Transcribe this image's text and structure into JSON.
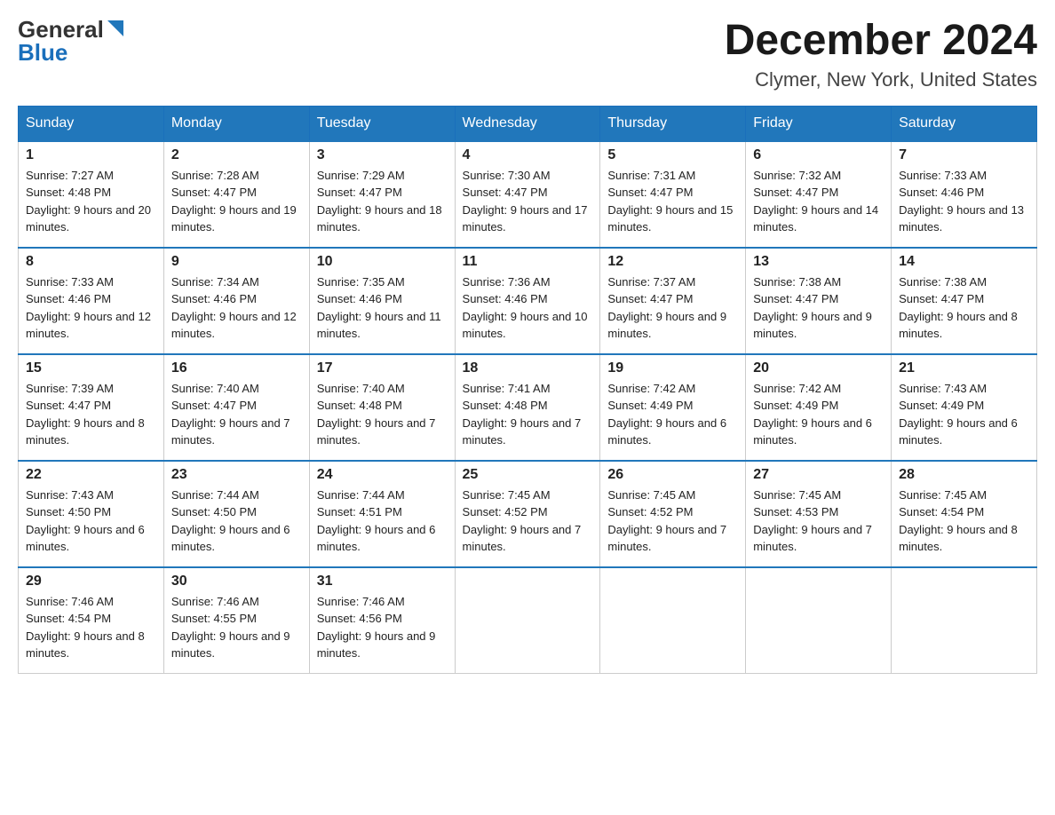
{
  "header": {
    "logo_general": "General",
    "logo_blue": "Blue",
    "month_title": "December 2024",
    "location": "Clymer, New York, United States"
  },
  "days_of_week": [
    "Sunday",
    "Monday",
    "Tuesday",
    "Wednesday",
    "Thursday",
    "Friday",
    "Saturday"
  ],
  "weeks": [
    [
      {
        "day": "1",
        "sunrise": "7:27 AM",
        "sunset": "4:48 PM",
        "daylight": "9 hours and 20 minutes."
      },
      {
        "day": "2",
        "sunrise": "7:28 AM",
        "sunset": "4:47 PM",
        "daylight": "9 hours and 19 minutes."
      },
      {
        "day": "3",
        "sunrise": "7:29 AM",
        "sunset": "4:47 PM",
        "daylight": "9 hours and 18 minutes."
      },
      {
        "day": "4",
        "sunrise": "7:30 AM",
        "sunset": "4:47 PM",
        "daylight": "9 hours and 17 minutes."
      },
      {
        "day": "5",
        "sunrise": "7:31 AM",
        "sunset": "4:47 PM",
        "daylight": "9 hours and 15 minutes."
      },
      {
        "day": "6",
        "sunrise": "7:32 AM",
        "sunset": "4:47 PM",
        "daylight": "9 hours and 14 minutes."
      },
      {
        "day": "7",
        "sunrise": "7:33 AM",
        "sunset": "4:46 PM",
        "daylight": "9 hours and 13 minutes."
      }
    ],
    [
      {
        "day": "8",
        "sunrise": "7:33 AM",
        "sunset": "4:46 PM",
        "daylight": "9 hours and 12 minutes."
      },
      {
        "day": "9",
        "sunrise": "7:34 AM",
        "sunset": "4:46 PM",
        "daylight": "9 hours and 12 minutes."
      },
      {
        "day": "10",
        "sunrise": "7:35 AM",
        "sunset": "4:46 PM",
        "daylight": "9 hours and 11 minutes."
      },
      {
        "day": "11",
        "sunrise": "7:36 AM",
        "sunset": "4:46 PM",
        "daylight": "9 hours and 10 minutes."
      },
      {
        "day": "12",
        "sunrise": "7:37 AM",
        "sunset": "4:47 PM",
        "daylight": "9 hours and 9 minutes."
      },
      {
        "day": "13",
        "sunrise": "7:38 AM",
        "sunset": "4:47 PM",
        "daylight": "9 hours and 9 minutes."
      },
      {
        "day": "14",
        "sunrise": "7:38 AM",
        "sunset": "4:47 PM",
        "daylight": "9 hours and 8 minutes."
      }
    ],
    [
      {
        "day": "15",
        "sunrise": "7:39 AM",
        "sunset": "4:47 PM",
        "daylight": "9 hours and 8 minutes."
      },
      {
        "day": "16",
        "sunrise": "7:40 AM",
        "sunset": "4:47 PM",
        "daylight": "9 hours and 7 minutes."
      },
      {
        "day": "17",
        "sunrise": "7:40 AM",
        "sunset": "4:48 PM",
        "daylight": "9 hours and 7 minutes."
      },
      {
        "day": "18",
        "sunrise": "7:41 AM",
        "sunset": "4:48 PM",
        "daylight": "9 hours and 7 minutes."
      },
      {
        "day": "19",
        "sunrise": "7:42 AM",
        "sunset": "4:49 PM",
        "daylight": "9 hours and 6 minutes."
      },
      {
        "day": "20",
        "sunrise": "7:42 AM",
        "sunset": "4:49 PM",
        "daylight": "9 hours and 6 minutes."
      },
      {
        "day": "21",
        "sunrise": "7:43 AM",
        "sunset": "4:49 PM",
        "daylight": "9 hours and 6 minutes."
      }
    ],
    [
      {
        "day": "22",
        "sunrise": "7:43 AM",
        "sunset": "4:50 PM",
        "daylight": "9 hours and 6 minutes."
      },
      {
        "day": "23",
        "sunrise": "7:44 AM",
        "sunset": "4:50 PM",
        "daylight": "9 hours and 6 minutes."
      },
      {
        "day": "24",
        "sunrise": "7:44 AM",
        "sunset": "4:51 PM",
        "daylight": "9 hours and 6 minutes."
      },
      {
        "day": "25",
        "sunrise": "7:45 AM",
        "sunset": "4:52 PM",
        "daylight": "9 hours and 7 minutes."
      },
      {
        "day": "26",
        "sunrise": "7:45 AM",
        "sunset": "4:52 PM",
        "daylight": "9 hours and 7 minutes."
      },
      {
        "day": "27",
        "sunrise": "7:45 AM",
        "sunset": "4:53 PM",
        "daylight": "9 hours and 7 minutes."
      },
      {
        "day": "28",
        "sunrise": "7:45 AM",
        "sunset": "4:54 PM",
        "daylight": "9 hours and 8 minutes."
      }
    ],
    [
      {
        "day": "29",
        "sunrise": "7:46 AM",
        "sunset": "4:54 PM",
        "daylight": "9 hours and 8 minutes."
      },
      {
        "day": "30",
        "sunrise": "7:46 AM",
        "sunset": "4:55 PM",
        "daylight": "9 hours and 9 minutes."
      },
      {
        "day": "31",
        "sunrise": "7:46 AM",
        "sunset": "4:56 PM",
        "daylight": "9 hours and 9 minutes."
      },
      null,
      null,
      null,
      null
    ]
  ]
}
